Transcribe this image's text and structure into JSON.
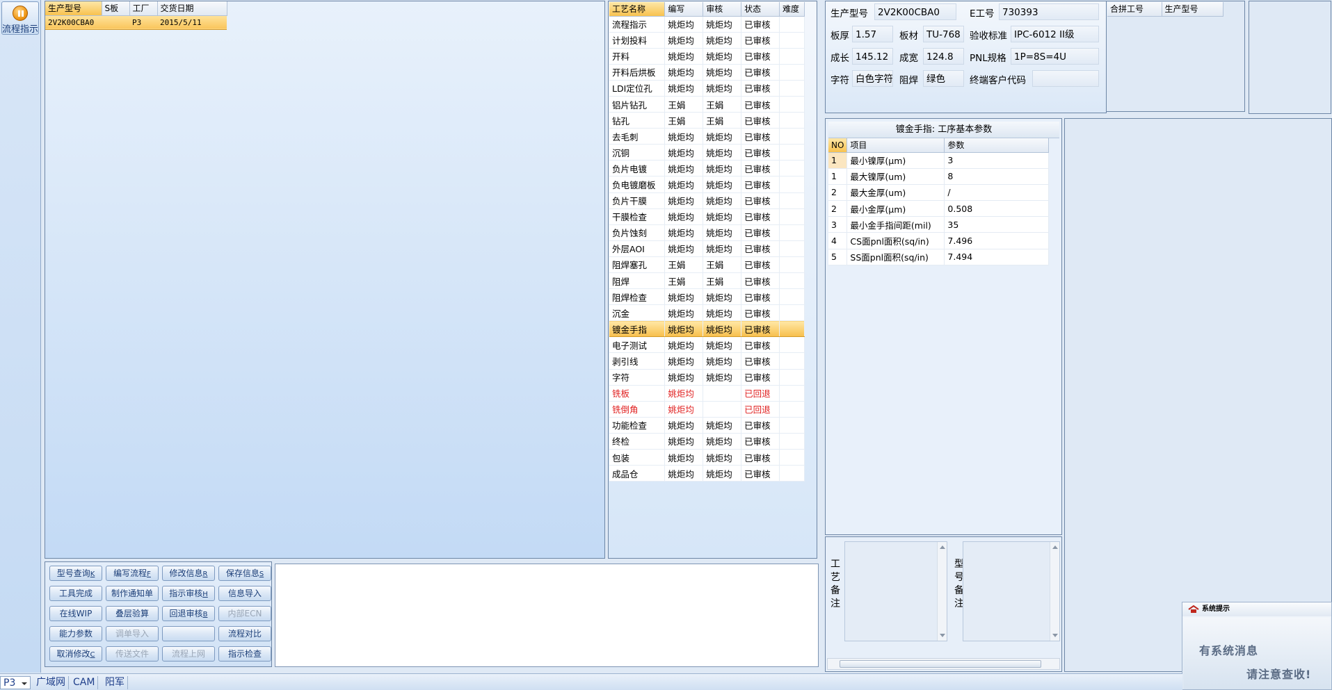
{
  "left_strip": {
    "flow_button_label": "流程指示"
  },
  "model_list": {
    "headers": [
      "生产型号",
      "S板",
      "工厂",
      "交货日期"
    ],
    "rows": [
      [
        "2V2K00CBA0",
        "",
        "P3",
        "2015/5/11"
      ]
    ]
  },
  "process_table": {
    "headers": [
      "工艺名称",
      "编写",
      "审核",
      "状态",
      "难度"
    ],
    "rows": [
      {
        "name": "流程指示",
        "writer": "姚炬均",
        "reviewer": "姚炬均",
        "status": "已审核"
      },
      {
        "name": "计划投料",
        "writer": "姚炬均",
        "reviewer": "姚炬均",
        "status": "已审核"
      },
      {
        "name": "开料",
        "writer": "姚炬均",
        "reviewer": "姚炬均",
        "status": "已审核"
      },
      {
        "name": "开料后烘板",
        "writer": "姚炬均",
        "reviewer": "姚炬均",
        "status": "已审核"
      },
      {
        "name": "LDI定位孔",
        "writer": "姚炬均",
        "reviewer": "姚炬均",
        "status": "已审核"
      },
      {
        "name": "铝片钻孔",
        "writer": "王娟",
        "reviewer": "王娟",
        "status": "已审核"
      },
      {
        "name": "钻孔",
        "writer": "王娟",
        "reviewer": "王娟",
        "status": "已审核"
      },
      {
        "name": "去毛刺",
        "writer": "姚炬均",
        "reviewer": "姚炬均",
        "status": "已审核"
      },
      {
        "name": "沉铜",
        "writer": "姚炬均",
        "reviewer": "姚炬均",
        "status": "已审核"
      },
      {
        "name": "负片电镀",
        "writer": "姚炬均",
        "reviewer": "姚炬均",
        "status": "已审核"
      },
      {
        "name": "负电镀磨板",
        "writer": "姚炬均",
        "reviewer": "姚炬均",
        "status": "已审核"
      },
      {
        "name": "负片干膜",
        "writer": "姚炬均",
        "reviewer": "姚炬均",
        "status": "已审核"
      },
      {
        "name": "干膜检查",
        "writer": "姚炬均",
        "reviewer": "姚炬均",
        "status": "已审核"
      },
      {
        "name": "负片蚀刻",
        "writer": "姚炬均",
        "reviewer": "姚炬均",
        "status": "已审核"
      },
      {
        "name": "外层AOI",
        "writer": "姚炬均",
        "reviewer": "姚炬均",
        "status": "已审核"
      },
      {
        "name": "阻焊塞孔",
        "writer": "王娟",
        "reviewer": "王娟",
        "status": "已审核"
      },
      {
        "name": "阻焊",
        "writer": "王娟",
        "reviewer": "王娟",
        "status": "已审核"
      },
      {
        "name": "阻焊检查",
        "writer": "姚炬均",
        "reviewer": "姚炬均",
        "status": "已审核"
      },
      {
        "name": "沉金",
        "writer": "姚炬均",
        "reviewer": "姚炬均",
        "status": "已审核"
      },
      {
        "name": "镀金手指",
        "writer": "姚炬均",
        "reviewer": "姚炬均",
        "status": "已审核",
        "selected": true
      },
      {
        "name": "电子测试",
        "writer": "姚炬均",
        "reviewer": "姚炬均",
        "status": "已审核"
      },
      {
        "name": "剥引线",
        "writer": "姚炬均",
        "reviewer": "姚炬均",
        "status": "已审核"
      },
      {
        "name": "字符",
        "writer": "姚炬均",
        "reviewer": "姚炬均",
        "status": "已审核"
      },
      {
        "name": "铣板",
        "writer": "姚炬均",
        "reviewer": "",
        "status": "已回退",
        "returned": true
      },
      {
        "name": "铣倒角",
        "writer": "姚炬均",
        "reviewer": "",
        "status": "已回退",
        "returned": true
      },
      {
        "name": "功能检查",
        "writer": "姚炬均",
        "reviewer": "姚炬均",
        "status": "已审核"
      },
      {
        "name": "终检",
        "writer": "姚炬均",
        "reviewer": "姚炬均",
        "status": "已审核"
      },
      {
        "name": "包装",
        "writer": "姚炬均",
        "reviewer": "姚炬均",
        "status": "已审核"
      },
      {
        "name": "成品仓",
        "writer": "姚炬均",
        "reviewer": "姚炬均",
        "status": "已审核"
      }
    ]
  },
  "buttons": [
    {
      "label": "型号查询",
      "key": "K",
      "disabled": false
    },
    {
      "label": "编写流程",
      "key": "F",
      "disabled": false
    },
    {
      "label": "修改信息",
      "key": "R",
      "disabled": false
    },
    {
      "label": "保存信息",
      "key": "S",
      "disabled": false
    },
    {
      "label": "工具完成",
      "key": "",
      "disabled": false
    },
    {
      "label": "制作通知单",
      "key": "",
      "disabled": false
    },
    {
      "label": "指示审核",
      "key": "H",
      "disabled": false
    },
    {
      "label": "信息导入",
      "key": "",
      "disabled": false
    },
    {
      "label": "在线WIP",
      "key": "",
      "disabled": false
    },
    {
      "label": "叠层验算",
      "key": "",
      "disabled": false
    },
    {
      "label": "回退审核",
      "key": "B",
      "disabled": false
    },
    {
      "label": "内部ECN",
      "key": "",
      "disabled": true
    },
    {
      "label": "能力参数",
      "key": "",
      "disabled": false
    },
    {
      "label": "调单导入",
      "key": "",
      "disabled": true
    },
    {
      "label": "",
      "key": "",
      "disabled": false
    },
    {
      "label": "流程对比",
      "key": "",
      "disabled": false
    },
    {
      "label": "取消修改",
      "key": "C",
      "disabled": false
    },
    {
      "label": "传送文件",
      "key": "",
      "disabled": true
    },
    {
      "label": "流程上网",
      "key": "",
      "disabled": true
    },
    {
      "label": "指示检查",
      "key": "",
      "disabled": false
    }
  ],
  "info": {
    "model_label": "生产型号",
    "model_value": "2V2K00CBA0",
    "e_label": "E工号",
    "e_value": "730393",
    "thickness_label": "板厚",
    "thickness_value": "1.57",
    "material_label": "板材",
    "material_value": "TU-768",
    "standard_label": "验收标准",
    "standard_value": "IPC-6012 II级",
    "length_label": "成长",
    "length_value": "145.12",
    "width_label": "成宽",
    "width_value": "124.8",
    "pnl_label": "PNL规格",
    "pnl_value": "1P=8S=4U",
    "char_label": "字符",
    "char_value": "白色字符",
    "mask_label": "阻焊",
    "mask_value": "绿色",
    "customer_label": "终端客户代码",
    "customer_value": ""
  },
  "combine": {
    "headers": [
      "合拼工号",
      "生产型号"
    ]
  },
  "params": {
    "title": "镀金手指: 工序基本参数",
    "headers": [
      "NO",
      "项目",
      "参数"
    ],
    "rows": [
      [
        "1",
        "最小镍厚(μm)",
        "3"
      ],
      [
        "1",
        "最大镍厚(um)",
        "8"
      ],
      [
        "2",
        "最大金厚(um)",
        "/"
      ],
      [
        "2",
        "最小金厚(μm)",
        "0.508"
      ],
      [
        "3",
        "最小金手指间距(mil)",
        "35"
      ],
      [
        "4",
        "CS面pnl面积(sq/in)",
        "7.496"
      ],
      [
        "5",
        "SS面pnl面积(sq/in)",
        "7.494"
      ]
    ]
  },
  "remarks": {
    "process_label": "工艺备注",
    "model_label": "型号备注"
  },
  "notification": {
    "title": "系统提示",
    "line1": "有系统消息",
    "line2": "请注意查收!"
  },
  "statusbar": {
    "factory": "P3",
    "items": [
      "广域网",
      "CAM",
      "阳军"
    ]
  }
}
